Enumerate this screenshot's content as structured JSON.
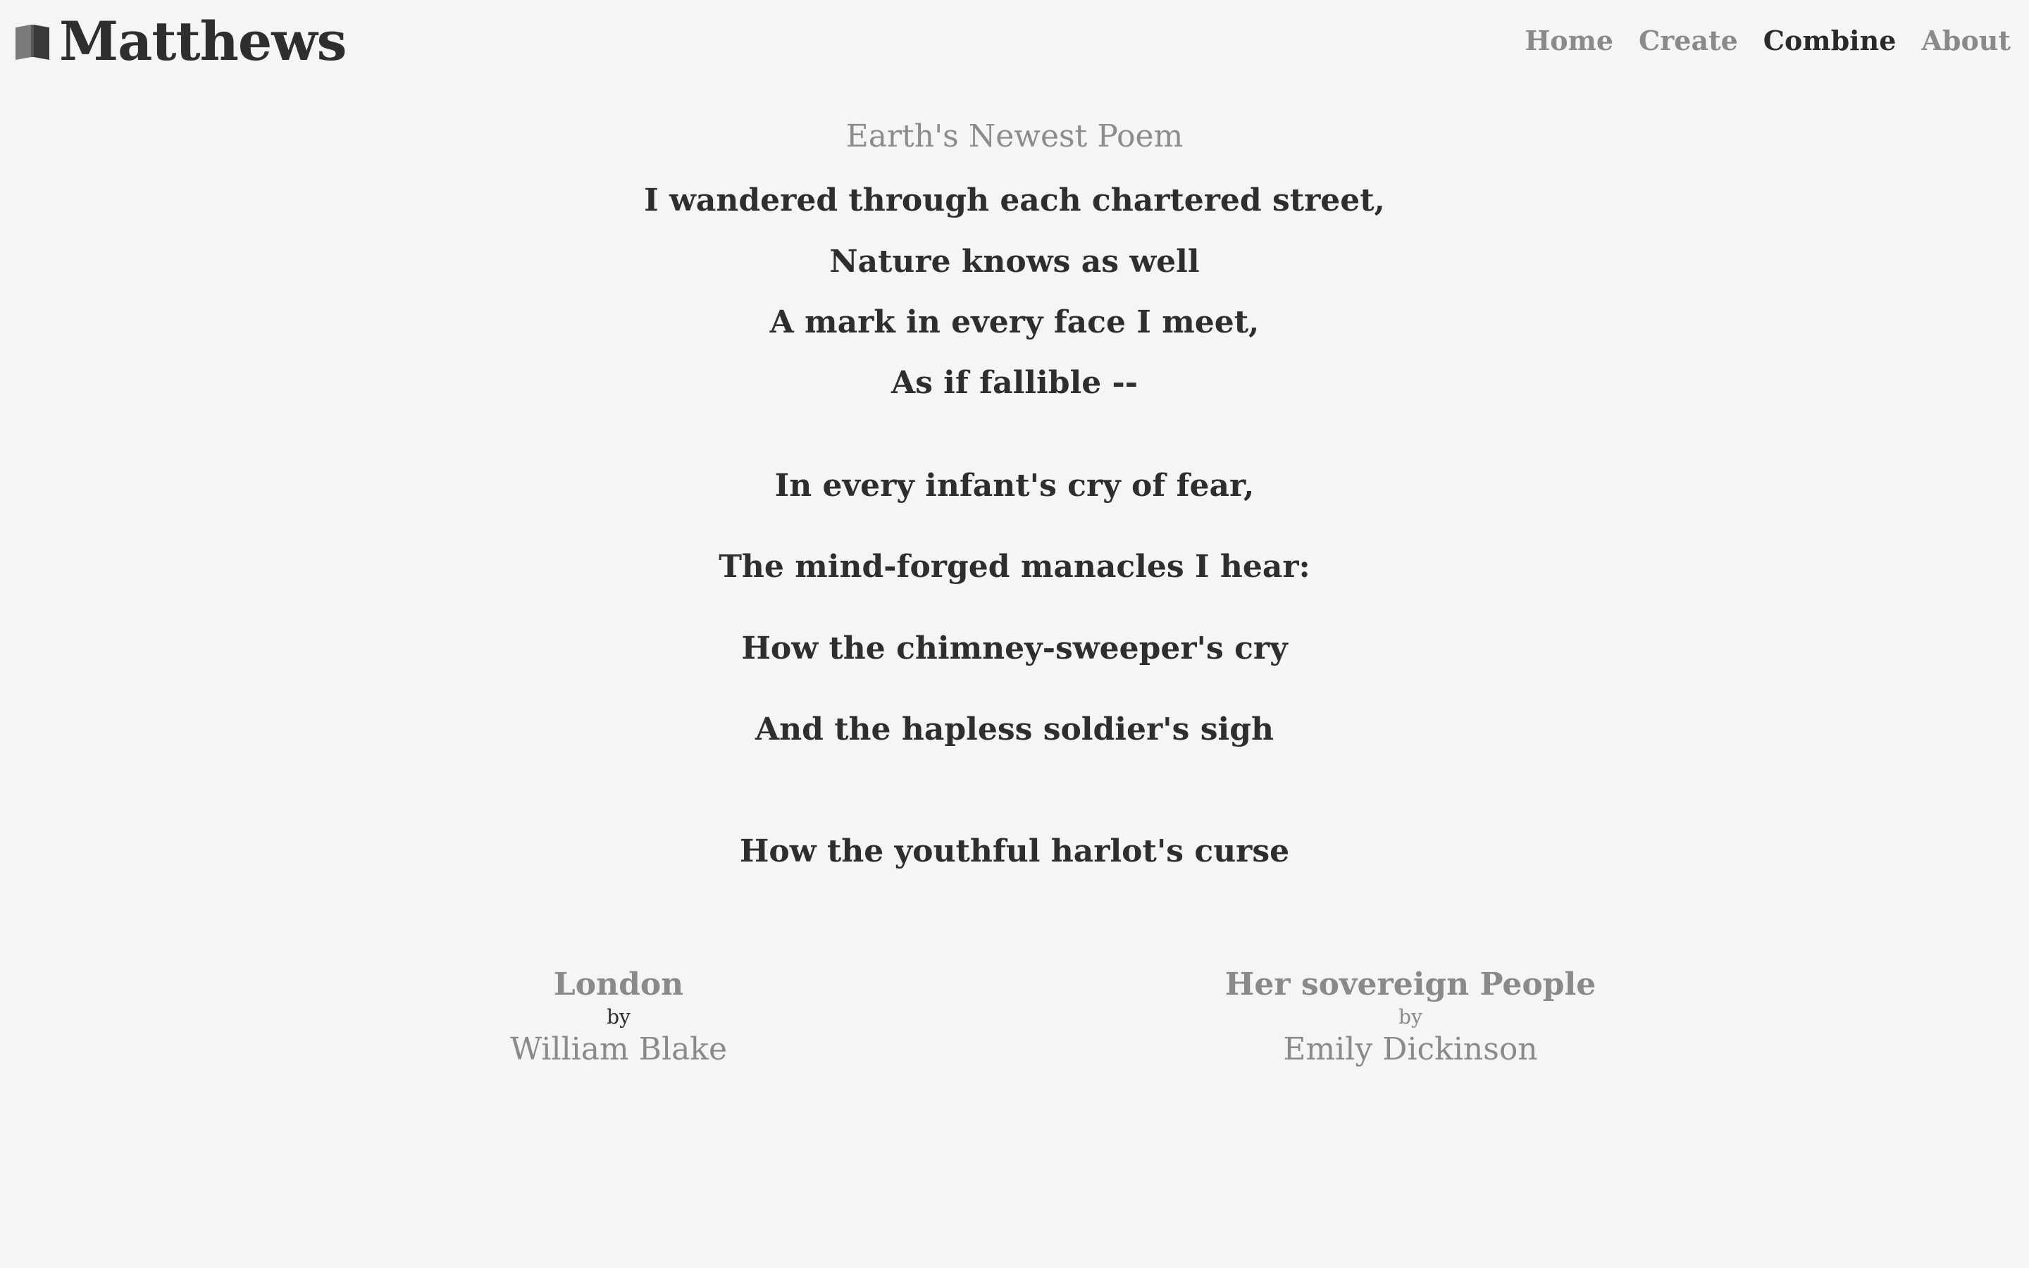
{
  "brand": {
    "name": "Matthews",
    "icon": "book-icon"
  },
  "nav": {
    "items": [
      {
        "label": "Home",
        "active": false
      },
      {
        "label": "Create",
        "active": false
      },
      {
        "label": "Combine",
        "active": true
      },
      {
        "label": "About",
        "active": false
      }
    ]
  },
  "poem": {
    "title": "Earth's Newest Poem",
    "lines": [
      "I wandered through each chartered street,",
      "Nature knows as well",
      "A mark in every face I meet,",
      "As if fallible --",
      "In every infant's cry of fear,",
      "The mind-forged manacles I hear:",
      "How the chimney-sweeper's cry",
      "And the hapless soldier's sigh",
      "How the youthful harlot's curse"
    ]
  },
  "sources": [
    {
      "title": "London",
      "by": "by",
      "author": "William Blake"
    },
    {
      "title": "Her sovereign People",
      "by": "by",
      "author": "Emily Dickinson"
    }
  ],
  "colors": {
    "background": "#f5f5f5",
    "text": "#2e2e2e",
    "muted": "#8a8a8a"
  }
}
